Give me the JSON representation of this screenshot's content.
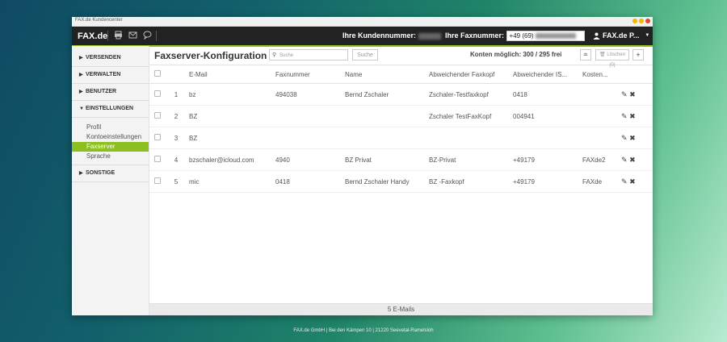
{
  "window_title": "FAX.de Kundencenter",
  "colors": {
    "accent": "#8cbf1f",
    "topbar": "#222222"
  },
  "topbar": {
    "logo": "FAX.de",
    "icons": [
      "printer-icon",
      "mail-icon",
      "chat-icon"
    ],
    "customer_label": "Ihre Kundennummer:",
    "fax_label": "Ihre Faxnummer:",
    "fax_value": "+49 (69)",
    "user": "FAX.de P..."
  },
  "sidebar": {
    "sections": [
      {
        "label": "VERSENDEN",
        "expanded": false
      },
      {
        "label": "VERWALTEN",
        "expanded": false
      },
      {
        "label": "BENUTZER",
        "expanded": false
      },
      {
        "label": "EINSTELLUNGEN",
        "expanded": true
      }
    ],
    "subitems": [
      "Profil",
      "Kontoeinstellungen",
      "Faxserver",
      "Sprache"
    ],
    "active_subitem": "Faxserver",
    "last_section": "SONSTIGE"
  },
  "main": {
    "title": "Faxserver-Konfiguration",
    "search_placeholder": "Suche",
    "search_button": "Suche",
    "accounts": "Konten möglich: 300 / 295 frei",
    "delete_button": "Löschen (0)",
    "columns": [
      "E-Mail",
      "Faxnummer",
      "Name",
      "Abweichender Faxkopf",
      "Abweichender IS...",
      "Kosten..."
    ],
    "rows": [
      {
        "n": "1",
        "email": "bz",
        "fax": "494038",
        "name": "Bernd Zschaler",
        "kopf": "Zschaler-Testfaxkopf",
        "is": "0418",
        "kosten": ""
      },
      {
        "n": "2",
        "email": "BZ",
        "fax": "",
        "name": "",
        "kopf": "Zschaler TestFaxKopf",
        "is": "004941",
        "kosten": ""
      },
      {
        "n": "3",
        "email": "BZ",
        "fax": "",
        "name": "",
        "kopf": "",
        "is": "",
        "kosten": ""
      },
      {
        "n": "4",
        "email": "bzschaler@icloud.com",
        "fax": "4940",
        "name": "BZ Privat",
        "kopf": "BZ-Privat",
        "is": "+49179",
        "kosten": "FAXde2"
      },
      {
        "n": "5",
        "email": "mic",
        "fax": "0418",
        "name": "Bernd Zschaler Handy",
        "kopf": "BZ -Faxkopf",
        "is": "+49179",
        "kosten": "FAXde"
      }
    ],
    "footer": "5 E-Mails"
  },
  "page_footer": "FAX.de GmbH | Bei den Kämpen 10 | 21220 Seevetal-Ramelsloh"
}
